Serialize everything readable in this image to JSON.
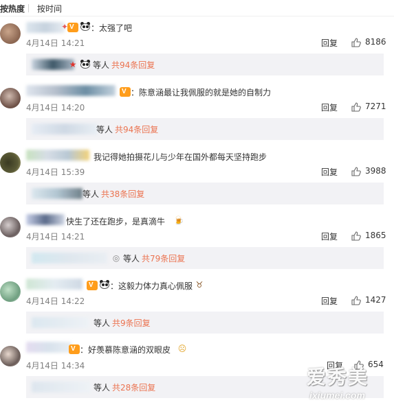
{
  "sort_tabs": {
    "hot": "按热度",
    "time": "按时间"
  },
  "comments": [
    {
      "text": "：太强了吧",
      "time": "4月14日 14:21",
      "reply": "回复",
      "likes": "8186",
      "sub": {
        "people": "等人",
        "link": "共94条回复"
      }
    },
    {
      "text": "：陈意涵最让我佩服的就是她的自制力",
      "time": "4月14日 14:20",
      "reply": "回复",
      "likes": "7271",
      "sub": {
        "people": "等人",
        "link": "共94条回复"
      }
    },
    {
      "text": "我记得她拍摄花儿与少年在国外都每天坚持跑步",
      "time": "4月14日 15:39",
      "reply": "回复",
      "likes": "3988",
      "sub": {
        "people": "等人",
        "link": "共38条回复"
      }
    },
    {
      "text": "快生了还在跑步，是真滴牛",
      "time": "4月14日 14:21",
      "reply": "回复",
      "likes": "1865",
      "sub": {
        "people": "等人",
        "link": "共79条回复"
      }
    },
    {
      "text": "：这毅力体力真心佩服",
      "time": "4月14日 14:22",
      "reply": "回复",
      "likes": "1427",
      "sub": {
        "people": "等人",
        "link": "共9条回复"
      }
    },
    {
      "text": "：好羡慕陈意涵的双眼皮",
      "time": "4月14日 14:34",
      "reply": "回复",
      "likes": "654",
      "sub": {
        "people": "等人",
        "link": "共28条回复"
      }
    }
  ],
  "watermark": {
    "cn": "爱秀美",
    "en": "ixiumei.com"
  },
  "colors": {
    "link": "#eb7350",
    "time": "#808080",
    "subbox": "#f2f2f5",
    "vip": "#ff9d1b"
  }
}
